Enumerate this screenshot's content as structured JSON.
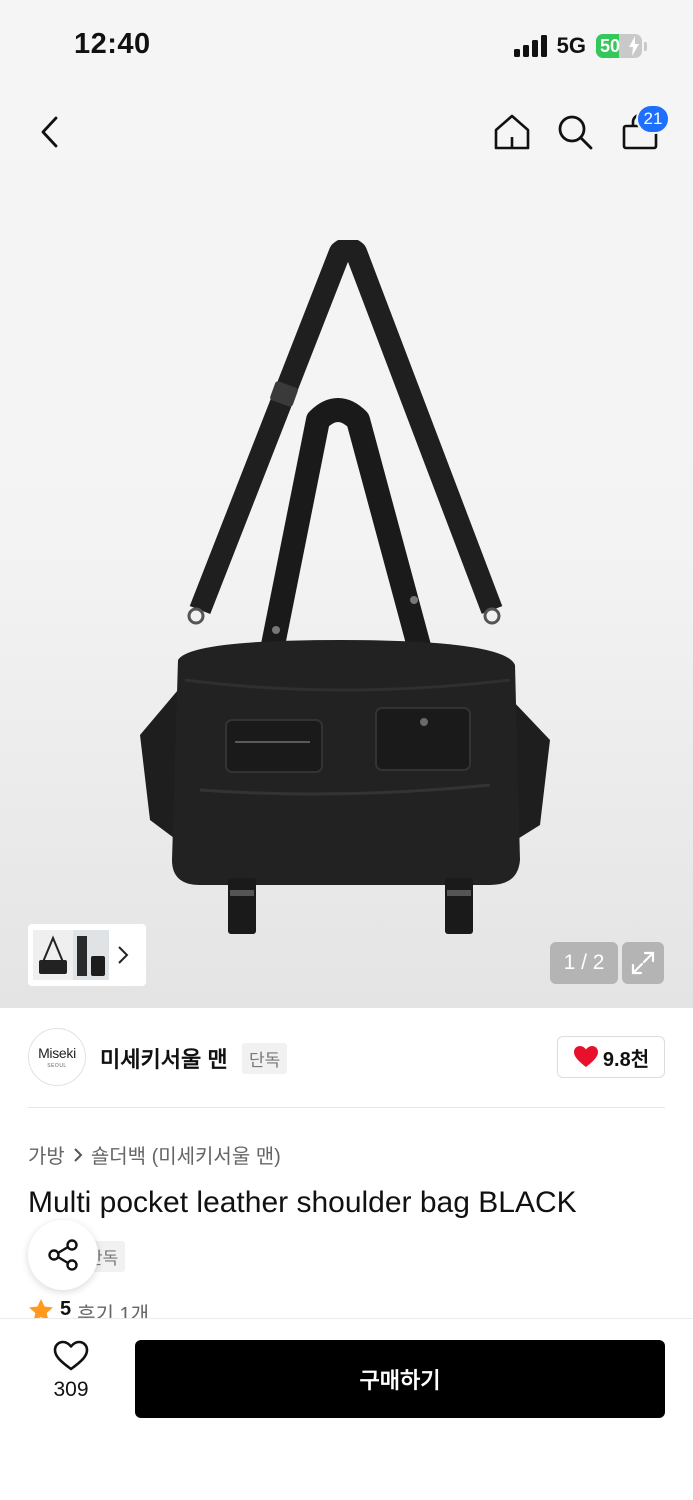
{
  "status_bar": {
    "time": "12:40",
    "network": "5G",
    "battery_percent": "50",
    "battery_level": 0.5
  },
  "nav": {
    "back_icon": "chevron-left-icon",
    "home_icon": "home-icon",
    "search_icon": "search-icon",
    "cart_icon": "shopping-bag-icon",
    "cart_badge": "21"
  },
  "gallery": {
    "page_counter": "1 / 2",
    "current_page": 1,
    "total_pages": 2,
    "expand_icon": "expand-icon"
  },
  "brand": {
    "logo_text": "Miseki",
    "logo_subtext": "SEOUL",
    "name": "미세키서울 맨",
    "tag": "단독",
    "like_count": "9.8천"
  },
  "breadcrumb": {
    "category": "가방",
    "subcategory": "숄더백 (미세키서울 맨)"
  },
  "product": {
    "title": "Multi pocket leather shoulder bag BLACK",
    "tag": "단독",
    "rating": "5",
    "review_count": "후기 1개"
  },
  "bottom": {
    "wish_count": "309",
    "buy_label": "구매하기"
  },
  "colors": {
    "accent_blue": "#1f6fff",
    "heart_red": "#e8102d",
    "star_orange": "#ff9a1f",
    "battery_green": "#34c759"
  }
}
